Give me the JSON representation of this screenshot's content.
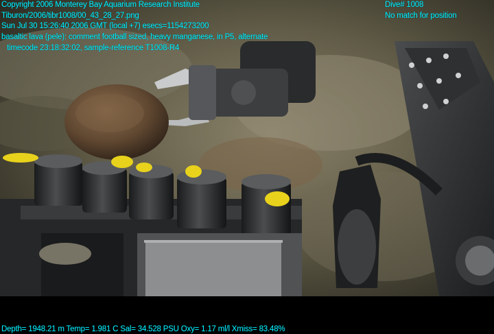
{
  "overlay": {
    "copyright": "Copyright 2006 Monterey Bay Aquarium Research Institute",
    "filename": "Tiburon/2006/tibr1008/00_43_28_27.png",
    "datetime": "Sun Jul 30 15:26:40 2006 GMT (local +7)  esecs=1154273200",
    "comment": "basaltic lava (pele): comment football sized, heavy manganese, in P5, alternate",
    "timecode": "timecode 23:18:32:02, sample-reference T1008-R4",
    "dive": "Dive# 1008",
    "position": "No match for position",
    "telemetry": "Depth= 1948.21 m  Temp= 1.981 C  Sal= 34.528 PSU  Oxy= 1.17 ml/l  Xmiss= 83.48%"
  },
  "colors": {
    "overlay_text": "#00f0ff",
    "seafloor": "#6f6a52",
    "background": "#000000"
  }
}
